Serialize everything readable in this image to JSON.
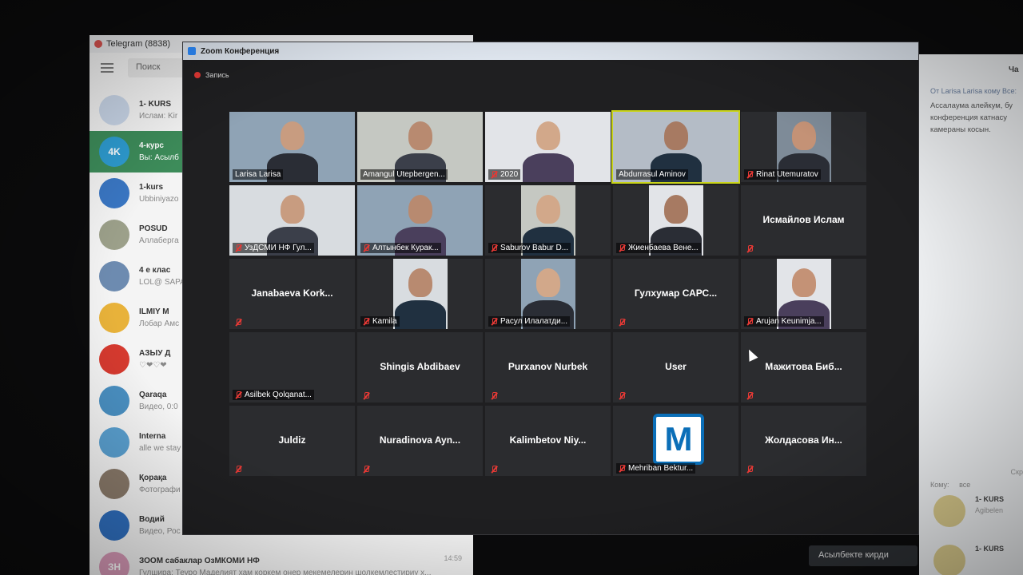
{
  "telegram": {
    "title": "Telegram (8838)",
    "search_placeholder": "Поиск",
    "chats": [
      {
        "avatar": "",
        "name": "1- KURS",
        "preview": "Ислам: Kir",
        "color": "#c9d6e8"
      },
      {
        "avatar": "4K",
        "name": "4-курс",
        "preview": "Вы: Асылб",
        "color": "#2e9cd1"
      },
      {
        "avatar": "",
        "name": "1-kurs",
        "preview": "Ubbiniyazo",
        "color": "#3a77c4"
      },
      {
        "avatar": "",
        "name": "POSUD",
        "preview": "Аллаберга",
        "color": "#9ca08a"
      },
      {
        "avatar": "",
        "name": "4 е клас",
        "preview": "LOL@ SAPA",
        "color": "#6d8bb0"
      },
      {
        "avatar": "",
        "name": "ILMIY M",
        "preview": "Лобар Амс",
        "color": "#e8b23a"
      },
      {
        "avatar": "",
        "name": "АЗЫУ Д",
        "preview": "♡❤♡❤",
        "color": "#d63a2f"
      },
      {
        "avatar": "",
        "name": "Qaraqa",
        "preview": "Видео, 0:0",
        "color": "#4a90c2"
      },
      {
        "avatar": "",
        "name": "Interna",
        "preview": "alle we stay",
        "color": "#5aa0d0"
      },
      {
        "avatar": "",
        "name": "Қорақа",
        "preview": "Фотографи",
        "color": "#8a7a6a"
      },
      {
        "avatar": "",
        "name": "Водий",
        "preview": "Видео, Рос",
        "color": "#2f6fbf"
      },
      {
        "avatar": "ЗН",
        "name": "ЗООМ сабаклар ОзМКОМИ НФ",
        "preview": "Гулшира: Теуро Маделият хам коркем онер мекемелерин шолкемлестириу х...",
        "time": "14:59",
        "color": "#d99ab8"
      }
    ]
  },
  "zoom": {
    "window_title": "Zoom Конференция",
    "recording_label": "Запись",
    "participants": [
      {
        "name": "Larisa Larisa",
        "video": true,
        "muted": false
      },
      {
        "name": "Amangul Utepbergen...",
        "video": true,
        "muted": false
      },
      {
        "name": "2020",
        "video": true,
        "muted": true
      },
      {
        "name": "Abdurrasul Aminov",
        "video": true,
        "muted": false,
        "speaking": true
      },
      {
        "name": "Rinat Utemuratov",
        "video": true,
        "muted": true
      },
      {
        "name": "УзДСМИ НФ Гул...",
        "video": true,
        "muted": true
      },
      {
        "name": "Алтынбек Курак...",
        "video": true,
        "muted": true
      },
      {
        "name": "Saburov Babur D...",
        "video": true,
        "muted": true
      },
      {
        "name": "Жиенбаева Вене...",
        "video": true,
        "muted": true
      },
      {
        "name": "Исмайлов Ислам",
        "video": false,
        "muted": true
      },
      {
        "name": "Janabaeva Kork...",
        "video": false,
        "muted": true
      },
      {
        "name": "Kamila",
        "video": true,
        "muted": true
      },
      {
        "name": "Расул Илалатди...",
        "video": true,
        "muted": true
      },
      {
        "name": "Гулхумар САРС...",
        "video": false,
        "muted": true
      },
      {
        "name": "Arujan Keunimja...",
        "video": true,
        "muted": true
      },
      {
        "name": "Asilbek Qolqanat...",
        "video": false,
        "muted": true,
        "show_label_only": true
      },
      {
        "name": "Shingis Abdibaev",
        "video": false,
        "muted": true
      },
      {
        "name": "Purxanov Nurbek",
        "video": false,
        "muted": true
      },
      {
        "name": "User",
        "video": false,
        "muted": true
      },
      {
        "name": "Мажитова Биб...",
        "video": false,
        "muted": true
      },
      {
        "name": "Juldiz",
        "video": false,
        "muted": true
      },
      {
        "name": "Nuradinova Ayn...",
        "video": false,
        "muted": true
      },
      {
        "name": "Kalimbetov Niy...",
        "video": false,
        "muted": true
      },
      {
        "name": "Mehriban Bektur...",
        "video": false,
        "muted": true,
        "logo": "M"
      },
      {
        "name": "Жолдасова Ин...",
        "video": false,
        "muted": true
      }
    ]
  },
  "chat_panel": {
    "title": "Ча",
    "from": "От Larisa Larisa кому Все:",
    "message": "Ассалаума алейкум, бу\nконференция катнасу\nкамераны косын.",
    "to_label": "Кому:",
    "to_value": "все",
    "side_label": "Скр",
    "rows": [
      {
        "name": "1- KURS",
        "preview": "Agibelen"
      },
      {
        "name": "1- KURS",
        "preview": ""
      }
    ]
  },
  "toast": "Асылбекте кирди",
  "colors": {
    "speaker_outline": "#c9d41a",
    "muted_red": "#e53935",
    "tile_bg": "#2b2c2f"
  }
}
